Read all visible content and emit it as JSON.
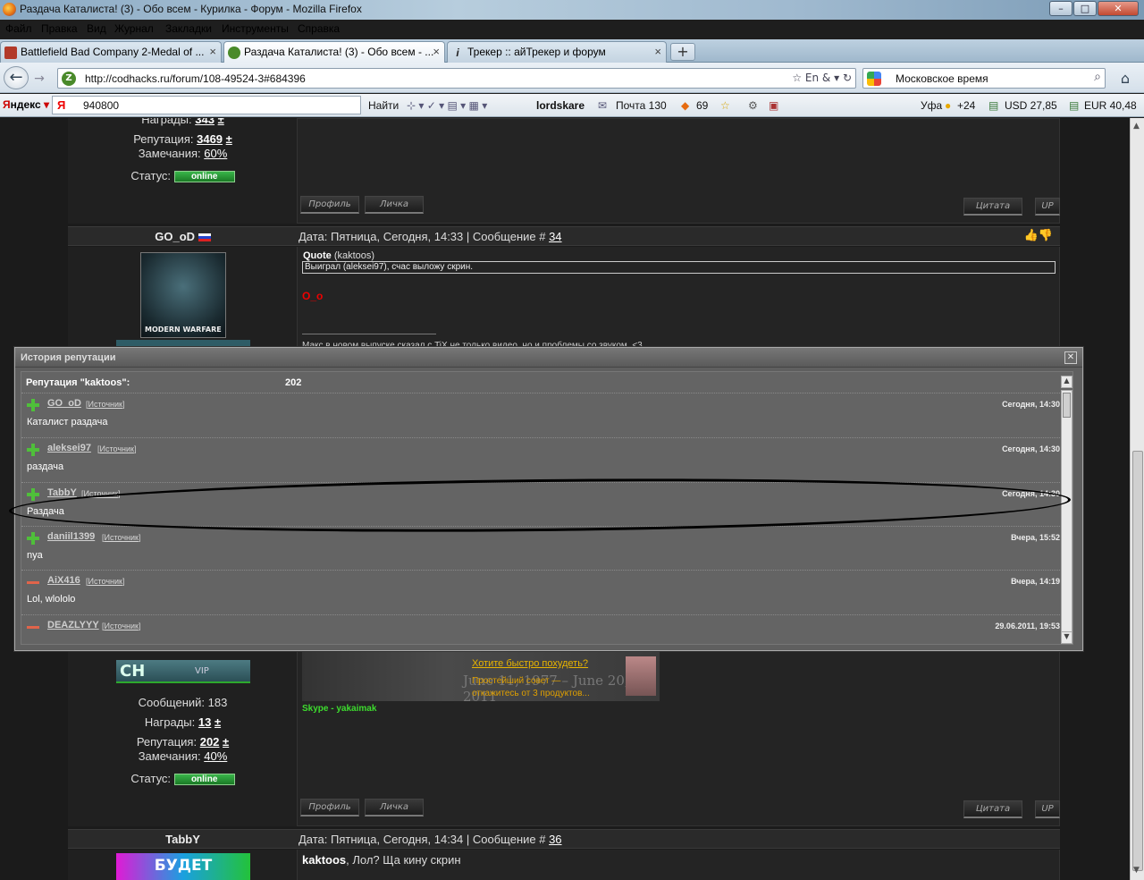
{
  "window": {
    "title": "Раздача Каталиста! (3) - Обо всем - Курилка - Форум - Mozilla Firefox",
    "controls": {
      "minimize": "–",
      "maximize": "□",
      "close": "✕"
    }
  },
  "menubar": [
    "Файл",
    "Правка",
    "Вид",
    "Журнал",
    "Закладки",
    "Инструменты",
    "Справка"
  ],
  "tabs": [
    {
      "label": "Battlefield Bad Company 2-Medal of ...",
      "icon": "game-icon",
      "color": "#b23a2a"
    },
    {
      "label": "Раздача Каталиста! (3) - Обо всем - ...",
      "icon": "forum-icon",
      "color": "#4a8a2a"
    },
    {
      "label": "Трекер :: айТрекер и форум",
      "icon": "i-icon",
      "color": "#333333"
    }
  ],
  "newtab_label": "+",
  "navbar": {
    "url": "http://codhacks.ru/forum/108-49524-3#684396",
    "site_badge": "Z",
    "url_tools": "☆ En & ▾ ↻",
    "search_value": "Московское время",
    "back": "←",
    "forward": "→",
    "home": "⌂",
    "search_go": "⌕"
  },
  "yandex_bar": {
    "logo_y": "Я",
    "logo_rest": "ндекс",
    "dropdown": "▾",
    "input_icon": "Я",
    "input_value": "940800",
    "find": "Найти",
    "user": "lordskare",
    "mail": "Почта 130",
    "count": "69",
    "city": "Уфа",
    "temp": "+24",
    "usd": "USD 27,85",
    "eur": "EUR 40,48"
  },
  "post_top": {
    "awards_label": "Награды:",
    "awards": "343",
    "rep_label": "Репутация:",
    "rep": "3469",
    "warn_label": "Замечания:",
    "warn": "60%",
    "status_label": "Статус:",
    "status": "online",
    "profile": "Профиль",
    "pm": "Личка",
    "quote": "Цитата",
    "up": "UP"
  },
  "post34": {
    "author": "GO_oD",
    "meta_prefix": "Дата: Пятница, Сегодня, 14:33 | Сообщение #",
    "number": "34",
    "avatar_text": "MODERN WARFARE",
    "quote_title": "Quote",
    "quote_author": "(kaktoos)",
    "quote_body": "Выиграл (aleksei97), счас выложу скрин.",
    "reply": "O_o",
    "signature": "Макс в новом выпуске сказал с TiX не только видео, но и проблемы со звуком. <3"
  },
  "post35": {
    "rank_badge": "CH",
    "vip": "VIP",
    "msgs_label": "Сообщений:",
    "msgs": "183",
    "awards_label": "Награды:",
    "awards": "13",
    "rep_label": "Репутация:",
    "rep": "202",
    "warn_label": "Замечания:",
    "warn": "40%",
    "status_label": "Статус:",
    "status": "online",
    "profile": "Профиль",
    "pm": "Личка",
    "quote": "Цитата",
    "up": "UP",
    "ad_title": "Хотите быстро похудеть?",
    "ad_line1": "Простейший совет —",
    "ad_line2": "откажитесь от 3 продуктов...",
    "sig_dates": "June 11, 1977 – June 20, 2011",
    "skype": "Skype - yakaimak"
  },
  "post36": {
    "author": "TabbY",
    "meta_prefix": "Дата: Пятница, Сегодня, 14:34 | Сообщение #",
    "number": "36",
    "avatar_text": "БУДЕТ БОЛЬНО",
    "reply_name": "kaktoos",
    "reply_text": ", Лол? Ща кину скрин"
  },
  "rep_dialog": {
    "title": "История репутации",
    "close": "✕",
    "summary_label": "Репутация \"kaktoos\":",
    "total": "202",
    "source_label": "Источник",
    "entries": [
      {
        "sign": "plus",
        "user": "GO_oD",
        "time": "Сегодня, 14:30",
        "comment": "Каталист раздача"
      },
      {
        "sign": "plus",
        "user": "aleksei97",
        "time": "Сегодня, 14:30",
        "comment": "раздача"
      },
      {
        "sign": "plus",
        "user": "TabbY",
        "time": "Сегодня, 14:30",
        "comment": "Раздача"
      },
      {
        "sign": "plus",
        "user": "daniil1399",
        "time": "Вчера, 15:52",
        "comment": "nya"
      },
      {
        "sign": "minus",
        "user": "AiX416",
        "time": "Вчера, 14:19",
        "comment": "Lol, wlololo"
      },
      {
        "sign": "minus",
        "user": "DEAZLYYY",
        "time": "29.06.2011, 19:53",
        "comment": ""
      }
    ]
  }
}
